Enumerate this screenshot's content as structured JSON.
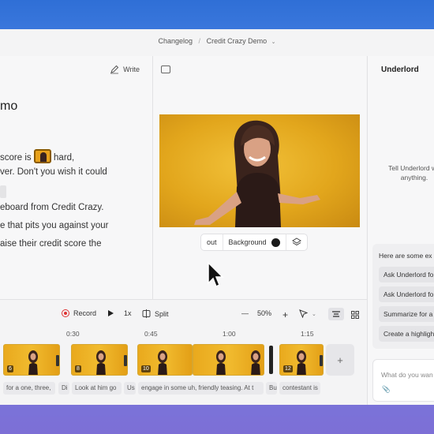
{
  "breadcrumb": {
    "section": "Changelog",
    "separator": "/",
    "project": "Credit Crazy Demo"
  },
  "script": {
    "write_label": "Write",
    "title": "mo",
    "lines": [
      {
        "before": "score is",
        "after": "hard,"
      },
      {
        "text": "ver. Don't you wish it could"
      },
      {
        "text": ""
      },
      {
        "text": "eboard from Credit Crazy."
      },
      {
        "text": "e that pits you against your"
      },
      {
        "text": "aise their credit score the"
      }
    ]
  },
  "video": {
    "layout_label": "out",
    "background_label": "Background",
    "background_color": "#1a1a1a"
  },
  "underlord": {
    "title": "Underlord",
    "description_line1": "Tell Underlord wh",
    "description_line2": "anything.",
    "suggestions_heading": "Here are some ex",
    "suggestions": [
      "Ask Underlord fo",
      "Ask Underlord fo",
      "Summarize for a",
      "Create a highligh"
    ],
    "input_placeholder": "What do you wan"
  },
  "timeline": {
    "record_label": "Record",
    "speed_label": "1x",
    "split_label": "Split",
    "zoom_label": "50%",
    "ruler": [
      "0:30",
      "0:45",
      "1:00",
      "1:15"
    ],
    "clips": [
      {
        "num": "6"
      },
      {
        "num": "8"
      },
      {
        "num": "10"
      },
      {
        "num": ""
      },
      {
        "num": "12"
      }
    ],
    "add_label": "+",
    "captions": [
      "for a one, three,",
      "Di",
      "Look at him go",
      "Us",
      "engage in some uh, friendly teasing. At t",
      "Bu",
      "contestant is"
    ]
  }
}
